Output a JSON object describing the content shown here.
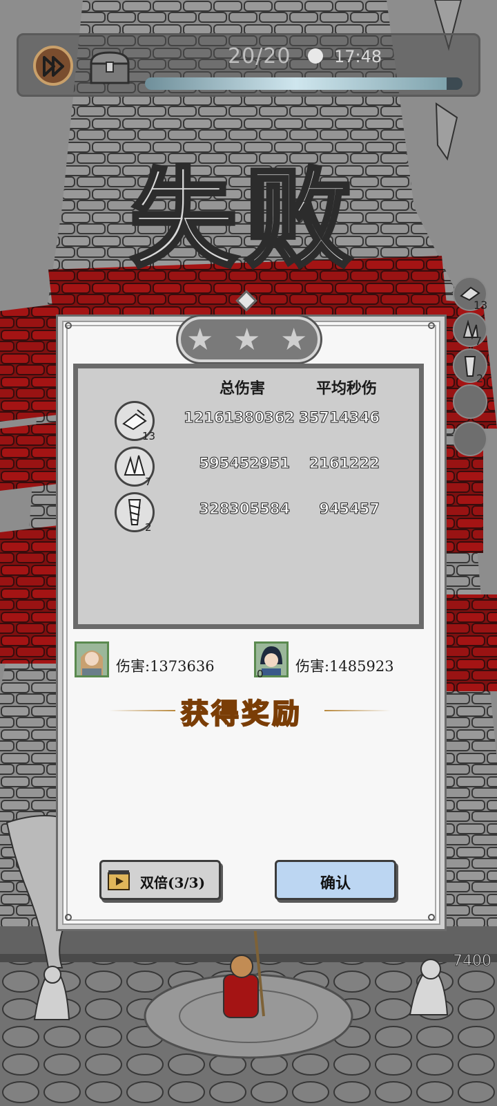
{
  "hud": {
    "energy": "20/20",
    "timer": "17:48",
    "speed_icon": "fast-forward-icon",
    "chest_icon": "treasure-chest-icon",
    "clock_icon": "clock-icon",
    "progress_fraction": 0.95
  },
  "result": {
    "title": "失败",
    "stars_earned": 0,
    "stars_total": 3
  },
  "side_skills": [
    {
      "icon": "crystal-shard-icon",
      "count": "13"
    },
    {
      "icon": "ice-cluster-icon",
      "count": "7"
    },
    {
      "icon": "drill-icon",
      "count": "2"
    },
    {
      "icon": "empty-slot-icon",
      "count": ""
    },
    {
      "icon": "empty-slot-icon",
      "count": ""
    }
  ],
  "stats": {
    "header_total": "总伤害",
    "header_dps": "平均秒伤",
    "rows": [
      {
        "icon": "crystal-shard-icon",
        "level": "13",
        "total": "12161380362",
        "dps": "35714346"
      },
      {
        "icon": "ice-cluster-icon",
        "level": "7",
        "total": "595452951",
        "dps": "2161222"
      },
      {
        "icon": "drill-icon",
        "level": "2",
        "total": "328305584",
        "dps": "945457"
      }
    ]
  },
  "heroes": [
    {
      "name_icon": "hero-portrait-female",
      "label": "伤害:1373636",
      "level": ""
    },
    {
      "name_icon": "hero-portrait-male",
      "label": "伤害:1485923",
      "level": "0"
    }
  ],
  "rewards": {
    "title": "获得奖励"
  },
  "buttons": {
    "double_label": "双倍(3/3)",
    "confirm_label": "确认"
  },
  "base_hp": "7400",
  "colors": {
    "accent_red": "#b51212",
    "confirm_blue": "#bcd6f2",
    "reward_gold": "#f6c046"
  }
}
